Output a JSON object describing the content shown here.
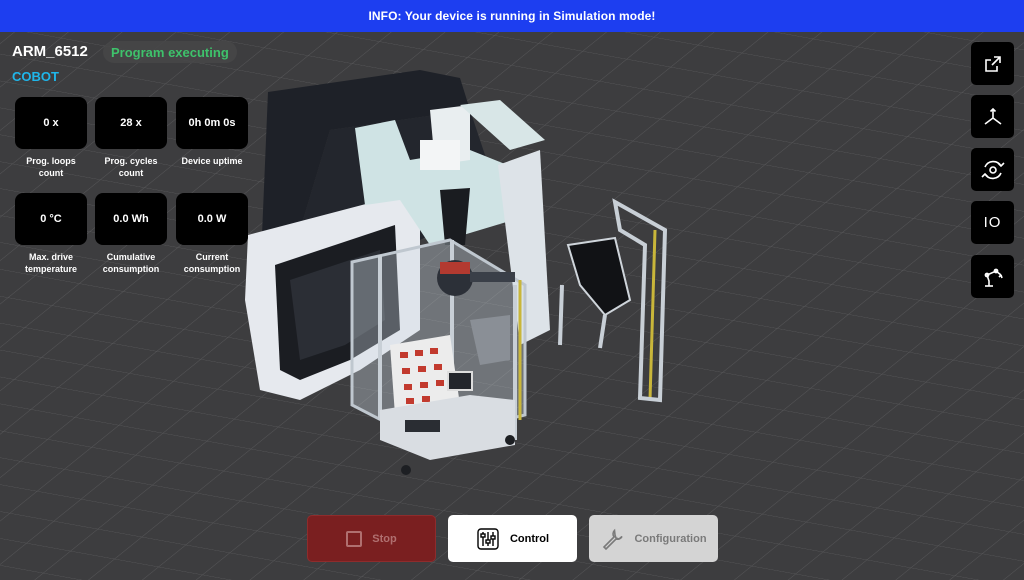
{
  "banner": {
    "text": "INFO: Your device is running in Simulation mode!"
  },
  "device": {
    "name": "ARM_6512",
    "status": "Program executing",
    "type": "COBOT"
  },
  "stats": [
    {
      "value": "0 x",
      "label": "Prog. loops count"
    },
    {
      "value": "28 x",
      "label": "Prog. cycles count"
    },
    {
      "value": "0h 0m 0s",
      "label": "Device uptime"
    },
    {
      "value": "0 °C",
      "label": "Max. drive temperature"
    },
    {
      "value": "0.0 Wh",
      "label": "Cumulative consumption"
    },
    {
      "value": "0.0 W",
      "label": "Current consumption"
    }
  ],
  "right_toolbar": {
    "io_label": "IO",
    "icons": [
      "external-link-icon",
      "axes-icon",
      "rotate-view-icon",
      "io-icon",
      "robot-arm-icon"
    ]
  },
  "bottom_bar": {
    "stop_label": "Stop",
    "control_label": "Control",
    "configuration_label": "Configuration"
  },
  "colors": {
    "banner": "#1d3ef0",
    "status_green": "#3ec26b",
    "type_cyan": "#1fb6ea",
    "stop_red": "#7a1f20"
  }
}
